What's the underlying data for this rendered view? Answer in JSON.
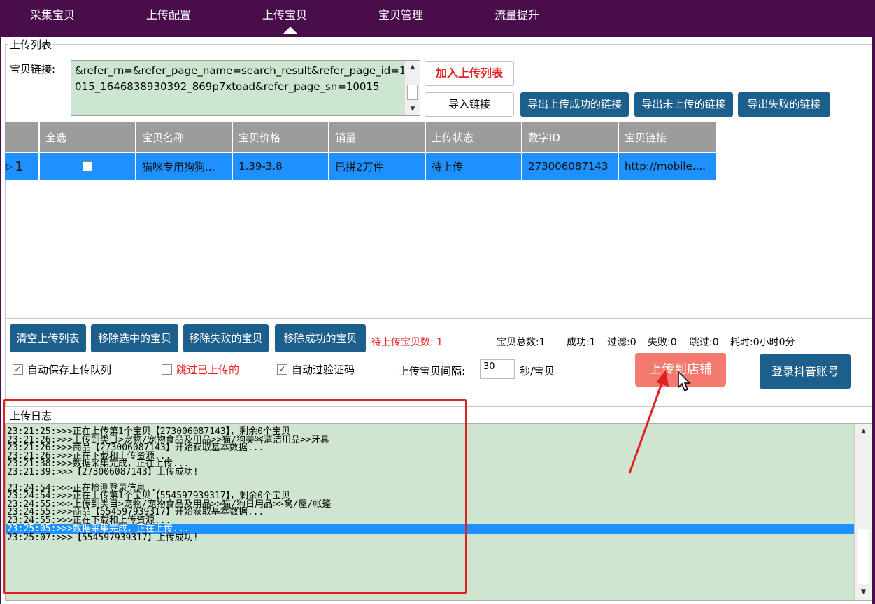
{
  "nav": {
    "tabs": [
      "采集宝贝",
      "上传配置",
      "上传宝贝",
      "宝贝管理",
      "流量提升"
    ],
    "active": "上传宝贝"
  },
  "upload_list": {
    "title": "上传列表",
    "link_label": "宝贝链接:",
    "link_value": "&refer_rn=&refer_page_name=search_result&refer_page_id=10015_1646838930392_869p7xtoad&refer_page_sn=10015",
    "add_button": "加入上传列表",
    "import_button": "导入链接",
    "export_success": "导出上传成功的链接",
    "export_not_uploaded": "导出未上传的链接",
    "export_failed": "导出失败的链接"
  },
  "grid": {
    "columns": [
      "全选",
      "宝贝名称",
      "宝贝价格",
      "销量",
      "上传状态",
      "数字ID",
      "宝贝链接"
    ],
    "rows": [
      {
        "index": "1",
        "name": "猫咪专用狗狗...",
        "price": "1.39-3.8",
        "sales": "已拼2万件",
        "status": "待上传",
        "id": "273006087143",
        "link": "http://mobile...."
      }
    ]
  },
  "actions": {
    "clear": "清空上传列表",
    "remove_selected": "移除选中的宝贝",
    "remove_failed": "移除失败的宝贝",
    "remove_success": "移除成功的宝贝",
    "pending": "待上传宝贝数: 1",
    "total": "宝贝总数:1",
    "success": "成功:1",
    "filtered": "过滤:0",
    "failed": "失败:0",
    "skipped": "跳过:0",
    "elapsed": "耗时:0小时0分"
  },
  "options": {
    "auto_save": "自动保存上传队列",
    "skip_uploaded": "跳过已上传的",
    "auto_captcha": "自动过验证码",
    "interval_label": "上传宝贝间隔:",
    "interval_value": "30",
    "interval_unit": "秒/宝贝",
    "upload_button": "上传到店铺",
    "login_button": "登录抖音账号"
  },
  "log": {
    "title": "上传日志",
    "lines": [
      "23:21:25:>>>正在上传第1个宝贝【273006087143】，剩余0个宝贝",
      "23:21:26:>>>上传到类目>宠物/宠物食品及用品>>猫/狗美容清洁用品>>牙具",
      "23:21:26:>>>商品【273006087143】开始获取基本数据...",
      "23:21:26:>>>正在下载和上传资源...",
      "23:21:38:>>>数据采集完成，正在上传...",
      "23:21:39:>>>【273006087143】上传成功!",
      "",
      "23:24:54:>>>正在检测登录信息...",
      "23:24:54:>>>正在上传第1个宝贝【554597939317】，剩余0个宝贝",
      "23:24:55:>>>上传到类目>宠物/宠物食品及用品>>猫/狗日用品>>窝/屋/帐篷",
      "23:24:55:>>>商品【554597939317】开始获取基本数据...",
      "23:24:55:>>>正在下载和上传资源...",
      "23:25:05:>>>数据采集完成，正在上传...",
      "23:25:07:>>>【554597939317】上传成功!"
    ],
    "selected_index": 12
  },
  "colors": {
    "nav_bg": "#4a0d4c",
    "accent_blue": "#1d5f8c",
    "row_selected": "#1e90ff",
    "upload_button": "#f47a70",
    "log_bg": "#cfe5d0",
    "annotation": "#e02020"
  }
}
